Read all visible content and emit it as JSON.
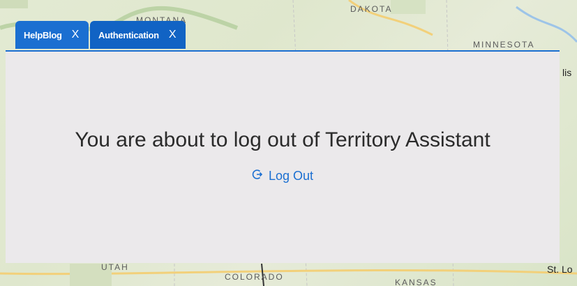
{
  "map": {
    "labels": {
      "montana": "MONTANA",
      "dakota": "DAKOTA",
      "minnesota": "MINNESOTA",
      "minneapolis": "lis",
      "utah": "UTAH",
      "colorado": "COLORADO",
      "kansas": "KANSAS",
      "st_louis": "St. Lo"
    }
  },
  "tabs": [
    {
      "label": "HelpBlog",
      "close": "X"
    },
    {
      "label": "Authentication",
      "close": "X"
    }
  ],
  "panel": {
    "message": "You are about to log out of Territory Assistant",
    "logout_label": "Log Out",
    "logout_icon": "logout-icon"
  },
  "colors": {
    "accent": "#1b6fd1",
    "panel": "#ebe9eb",
    "tab": "#1163c4"
  }
}
